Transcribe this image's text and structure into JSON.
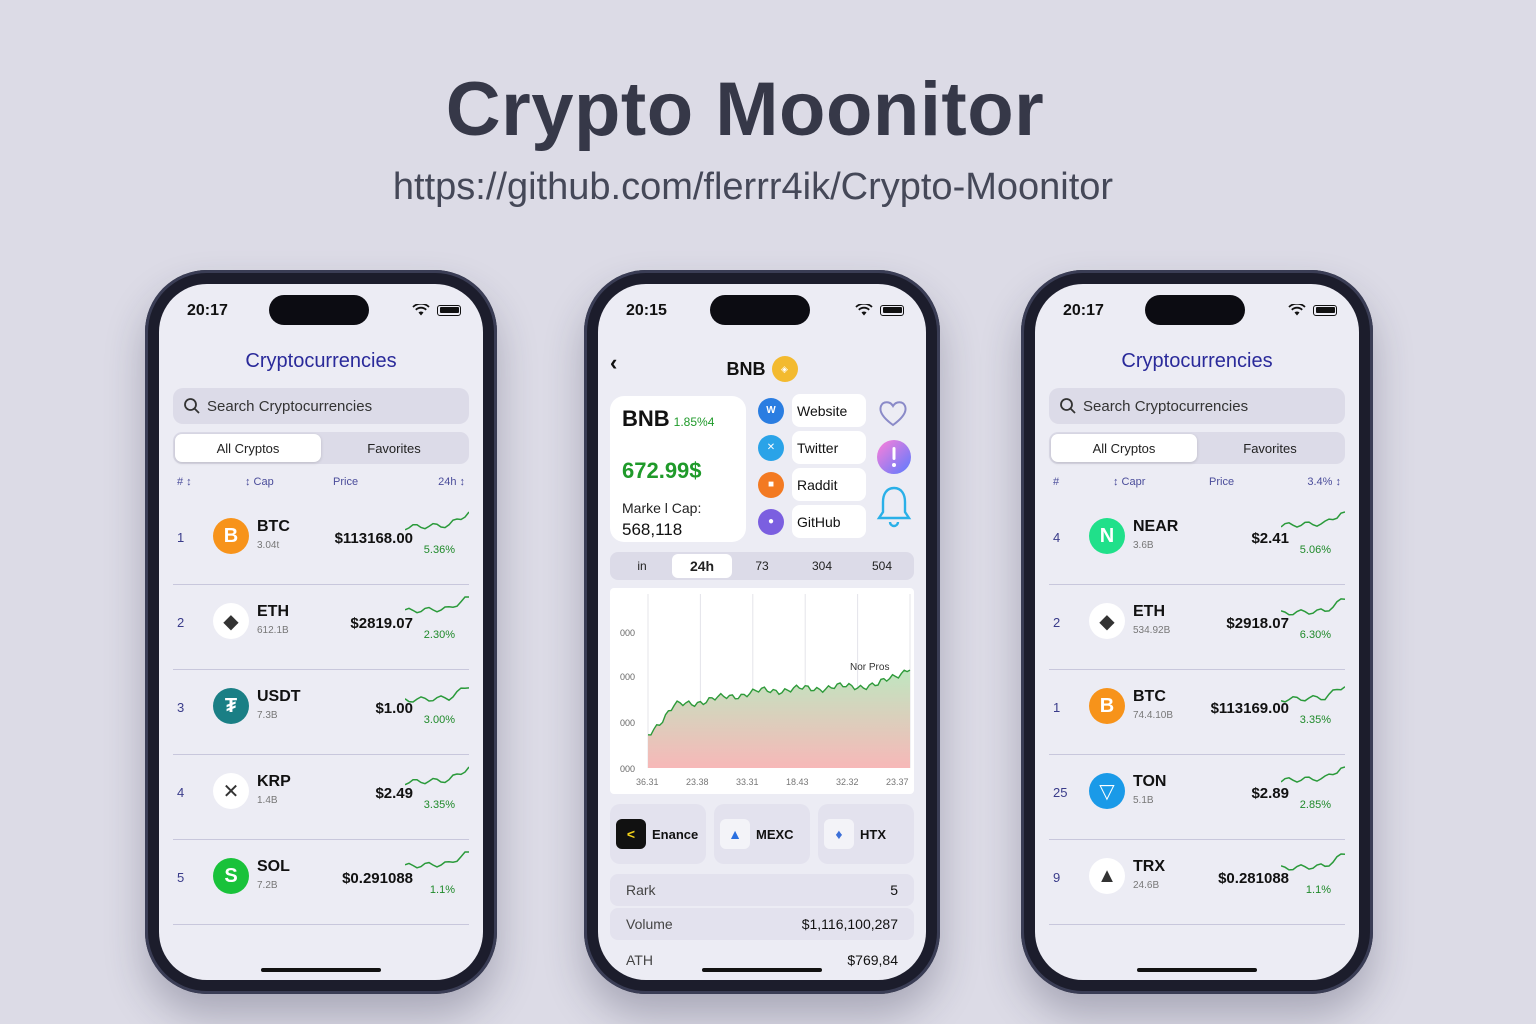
{
  "header": {
    "title": "Crypto Moonitor",
    "url": "https://github.com/flerrr4ik/Crypto-Moonitor"
  },
  "phone_left": {
    "time": "20:17",
    "title": "Cryptocurrencies",
    "search_placeholder": "Search Cryptocurrencies",
    "tabs": [
      "All Cryptos",
      "Favorites"
    ],
    "columns": [
      "# ↕",
      "↕ Cap",
      "Price",
      "24h ↕"
    ],
    "rows": [
      {
        "rank": "1",
        "symbol": "BTC",
        "cap": "3.04t",
        "price": "$113168.00",
        "change": "5.36%",
        "icon": "bitcoin-icon",
        "color": "#f7931a",
        "glyph": "B"
      },
      {
        "rank": "2",
        "symbol": "ETH",
        "cap": "612.1B",
        "price": "$2819.07",
        "change": "2.30%",
        "icon": "ethereum-icon",
        "color": "#ffffff",
        "glyph": "◆"
      },
      {
        "rank": "3",
        "symbol": "USDT",
        "cap": "7.3B",
        "price": "$1.00",
        "change": "3.00%",
        "icon": "tether-icon",
        "color": "#1a7f85",
        "glyph": "₮"
      },
      {
        "rank": "4",
        "symbol": "KRP",
        "cap": "1.4B",
        "price": "$2.49",
        "change": "3.35%",
        "icon": "xrp-icon",
        "color": "#ffffff",
        "glyph": "✕"
      },
      {
        "rank": "5",
        "symbol": "SOL",
        "cap": "7.2B",
        "price": "$0.291088",
        "change": "1.1%",
        "icon": "sol-icon",
        "color": "#19c23a",
        "glyph": "S"
      }
    ]
  },
  "phone_middle": {
    "time": "20:15",
    "title": "BNB",
    "price_card": {
      "symbol": "BNB",
      "change": "1.85%4",
      "price": "672.99$",
      "cap_label": "Marke l Cap:",
      "cap_value": "568,118"
    },
    "links": [
      {
        "label": "Website",
        "icon": "globe-icon",
        "color": "#2a7de1",
        "glyph": "W"
      },
      {
        "label": "Twitter",
        "icon": "twitter-x-icon",
        "color": "#2aa3e8",
        "glyph": "✕"
      },
      {
        "label": "Raddit",
        "icon": "reddit-icon",
        "color": "#f37a22",
        "glyph": "■"
      },
      {
        "label": "GitHub",
        "icon": "github-icon",
        "color": "#7b5fe0",
        "glyph": "●"
      }
    ],
    "timeframes": [
      "in",
      "24h",
      "73",
      "304",
      "504"
    ],
    "active_timeframe": "24h",
    "chart_y_ticks": [
      "000",
      "000",
      "000",
      "000"
    ],
    "chart_x_ticks": [
      "36.31",
      "23.38",
      "33.31",
      "18.43",
      "32.32",
      "23.37"
    ],
    "chart_label": "Nor Pros",
    "exchanges": [
      {
        "name": "Enance",
        "icon": "binance-icon",
        "color": "#111111",
        "glyph": "<"
      },
      {
        "name": "MEXC",
        "icon": "mexc-icon",
        "color": "#2a6fe0",
        "glyph": "▲"
      },
      {
        "name": "HTX",
        "icon": "htx-icon",
        "color": "#3b6fd8",
        "glyph": "♦"
      }
    ],
    "stats": [
      {
        "label": "Rark",
        "value": "5"
      },
      {
        "label": "Volume",
        "value": "$1,116,100,287"
      },
      {
        "label": "ATH",
        "value": "$769,84"
      }
    ]
  },
  "phone_right": {
    "time": "20:17",
    "title": "Cryptocurrencies",
    "search_placeholder": "Search Cryptocurrencies",
    "tabs": [
      "All Cryptos",
      "Favorites"
    ],
    "columns": [
      "#",
      "↕ Capr",
      "Price",
      "3.4% ↕"
    ],
    "rows": [
      {
        "rank": "4",
        "symbol": "NEAR",
        "cap": "3.6B",
        "price": "$2.41",
        "change": "5.06%",
        "icon": "near-icon",
        "color": "#20e08a",
        "glyph": "N"
      },
      {
        "rank": "2",
        "symbol": "ETH",
        "cap": "534.92B",
        "price": "$2918.07",
        "change": "6.30%",
        "icon": "ethereum-icon",
        "color": "#ffffff",
        "glyph": "◆"
      },
      {
        "rank": "1",
        "symbol": "BTC",
        "cap": "74.4.10B",
        "price": "$113169.00",
        "change": "3.35%",
        "icon": "bitcoin-icon",
        "color": "#f7931a",
        "glyph": "B"
      },
      {
        "rank": "25",
        "symbol": "TON",
        "cap": "5.1B",
        "price": "$2.89",
        "change": "2.85%",
        "icon": "ton-icon",
        "color": "#1a9ae8",
        "glyph": "▽"
      },
      {
        "rank": "9",
        "symbol": "TRX",
        "cap": "24.6B",
        "price": "$0.281088",
        "change": "1.1%",
        "icon": "tron-icon",
        "color": "#ffffff",
        "glyph": "▲"
      }
    ]
  },
  "colors": {
    "accent": "#2a2a9a",
    "positive": "#1f9a2a",
    "background": "#dcdbe6"
  }
}
